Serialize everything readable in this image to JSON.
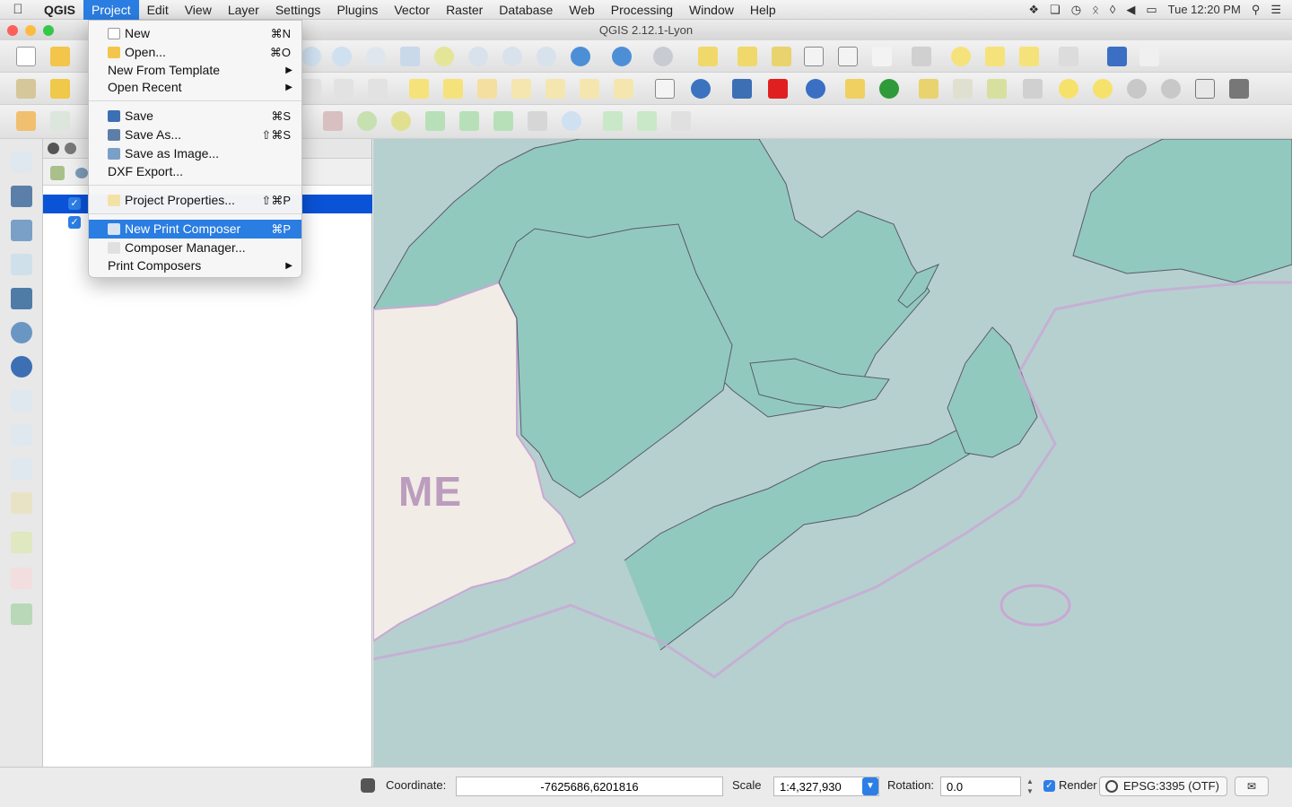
{
  "menubar": {
    "app_name": "QGIS",
    "items": [
      "Project",
      "Edit",
      "View",
      "Layer",
      "Settings",
      "Plugins",
      "Vector",
      "Raster",
      "Database",
      "Web",
      "Processing",
      "Window",
      "Help"
    ],
    "clock": "Tue 12:20 PM"
  },
  "window": {
    "title": "QGIS 2.12.1-Lyon"
  },
  "project_menu": {
    "new": "New",
    "new_sc": "⌘N",
    "open": "Open...",
    "open_sc": "⌘O",
    "new_from_template": "New From Template",
    "open_recent": "Open Recent",
    "save": "Save",
    "save_sc": "⌘S",
    "save_as": "Save As...",
    "save_as_sc": "⇧⌘S",
    "save_as_image": "Save as Image...",
    "dxf_export": "DXF Export...",
    "project_properties": "Project Properties...",
    "project_properties_sc": "⇧⌘P",
    "new_print_composer": "New Print Composer",
    "new_print_composer_sc": "⌘P",
    "composer_manager": "Composer Manager...",
    "print_composers": "Print Composers"
  },
  "map": {
    "label": "ME"
  },
  "statusbar": {
    "coordinate_label": "Coordinate:",
    "coordinate_value": "-7625686,6201816",
    "scale_label": "Scale",
    "scale_value": "1:4,327,930",
    "rotation_label": "Rotation:",
    "rotation_value": "0.0",
    "render_label": "Render",
    "epsg": "EPSG:3395 (OTF)"
  },
  "colors": {
    "accent": "#2a7de1",
    "land": "#92c9bf",
    "water": "#b6d0d0",
    "maine": "#f1ede6",
    "border": "#c9a8d4"
  }
}
